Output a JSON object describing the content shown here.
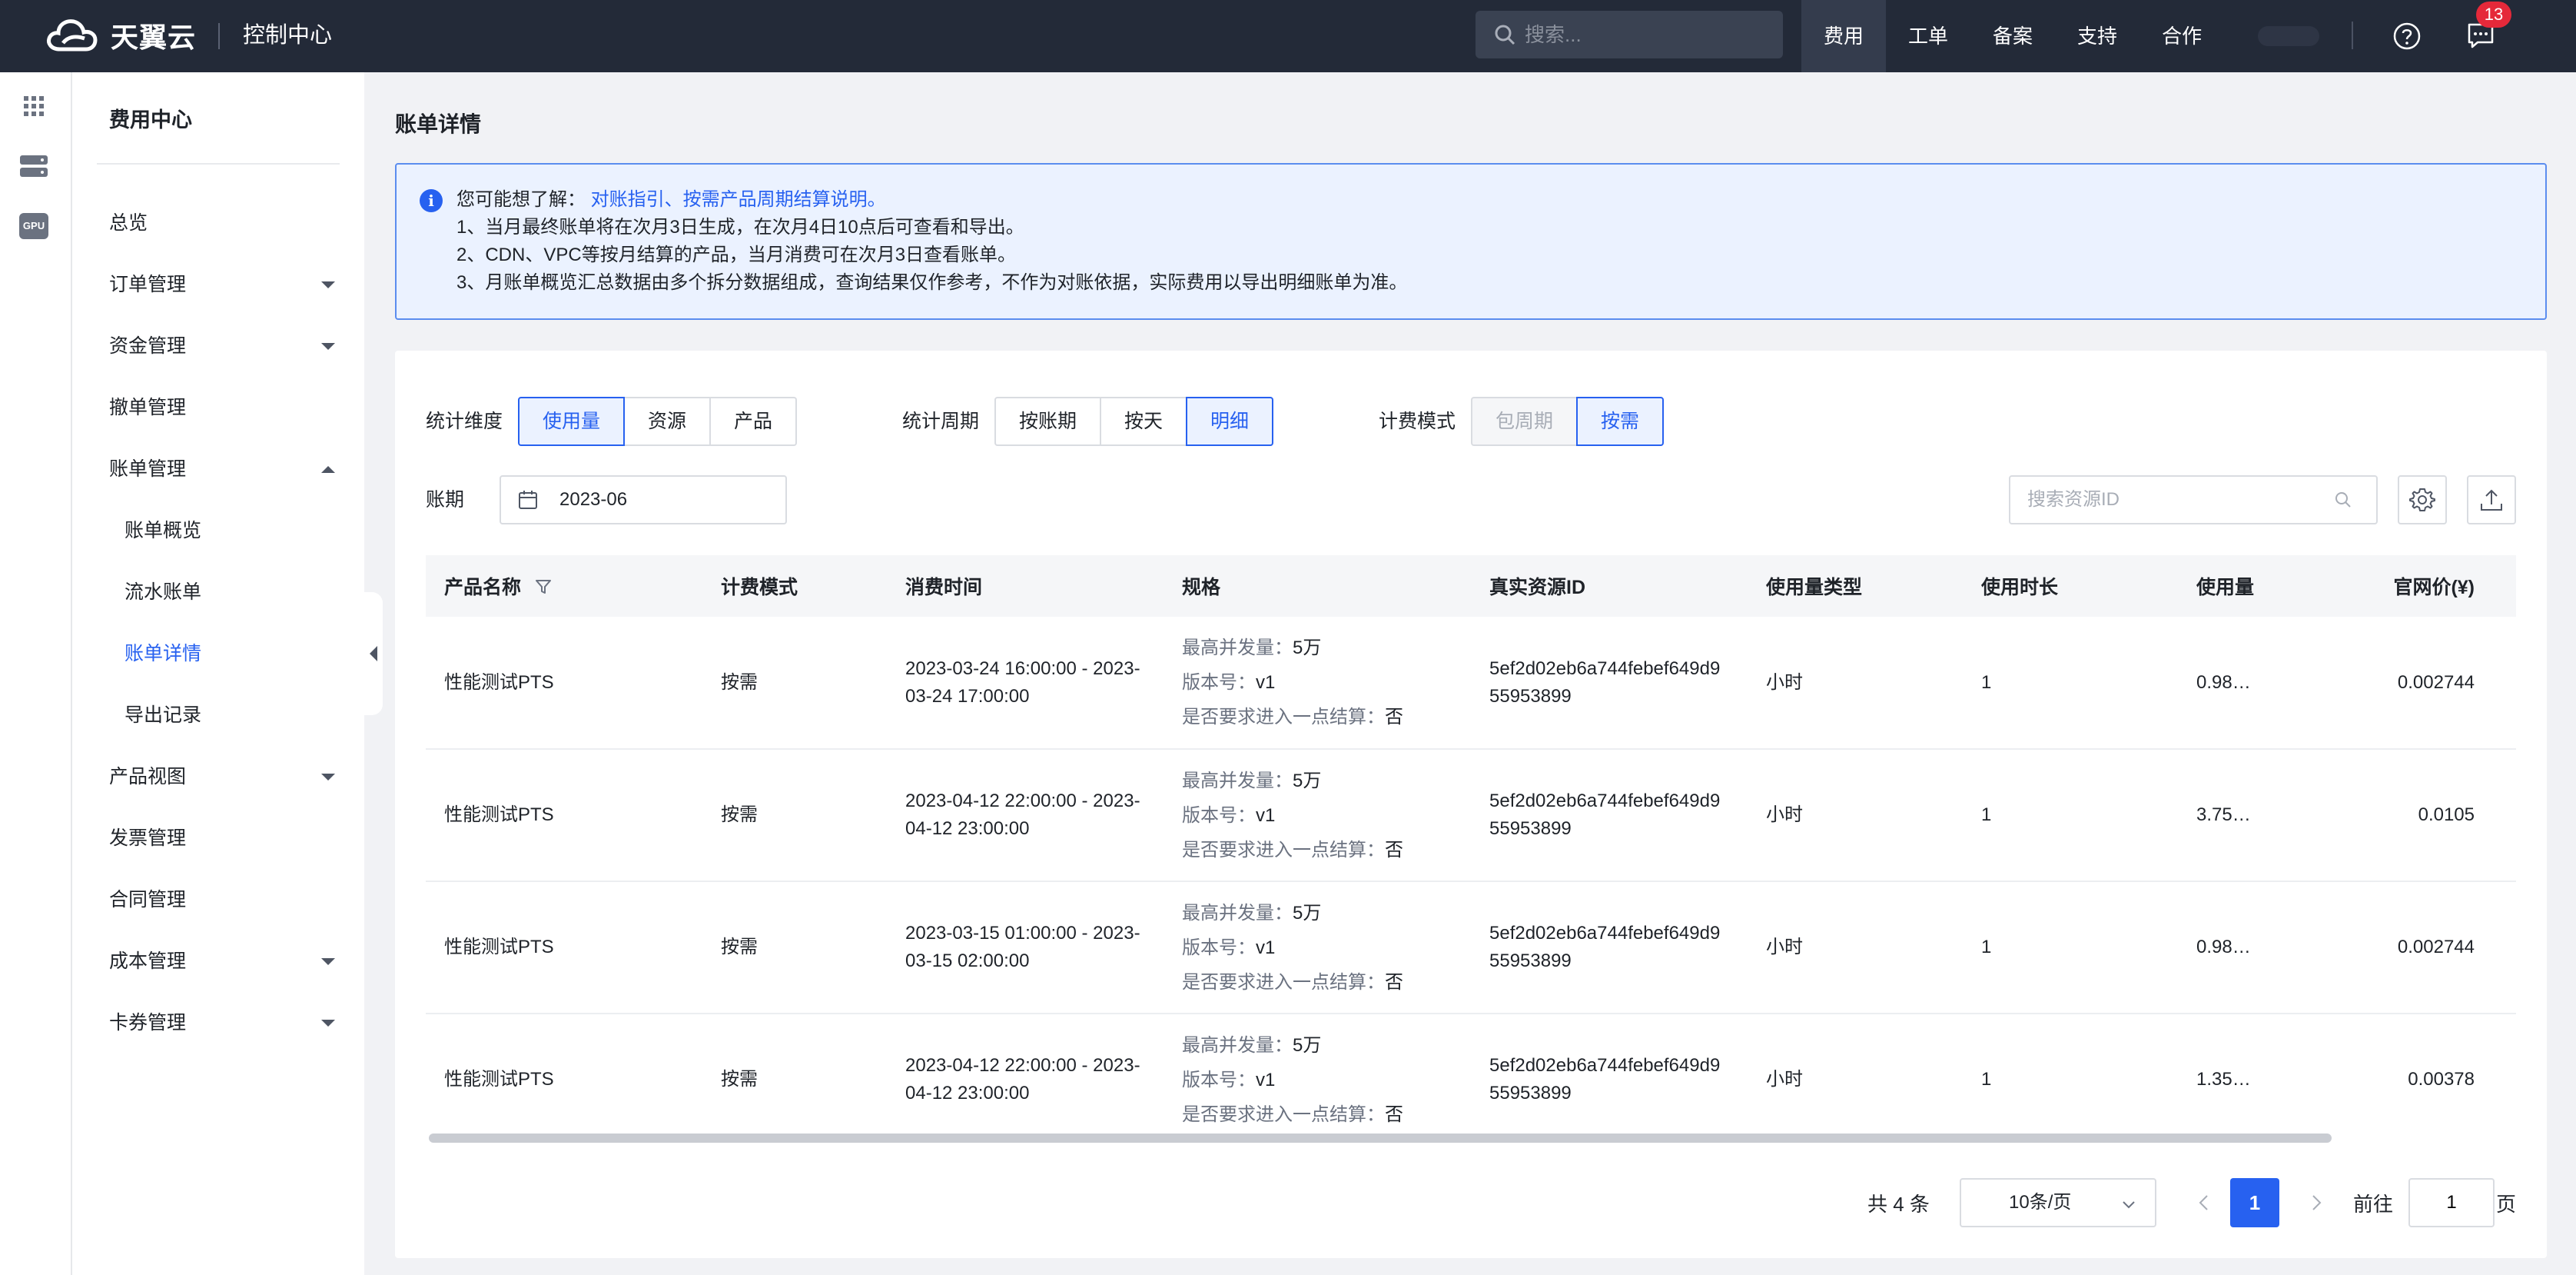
{
  "topbar": {
    "logo_text": "天翼云",
    "console_title": "控制中心",
    "search_placeholder": "搜索...",
    "nav": [
      "费用",
      "工单",
      "备案",
      "支持",
      "合作"
    ],
    "message_count": "13"
  },
  "rail": {
    "gpu_label": "GPU"
  },
  "sidebar": {
    "title": "费用中心",
    "items": [
      {
        "label": "总览"
      },
      {
        "label": "订单管理"
      },
      {
        "label": "资金管理"
      },
      {
        "label": "撤单管理"
      },
      {
        "label": "账单管理"
      },
      {
        "label": "账单概览"
      },
      {
        "label": "流水账单"
      },
      {
        "label": "账单详情"
      },
      {
        "label": "导出记录"
      },
      {
        "label": "产品视图"
      },
      {
        "label": "发票管理"
      },
      {
        "label": "合同管理"
      },
      {
        "label": "成本管理"
      },
      {
        "label": "卡券管理"
      }
    ]
  },
  "page": {
    "title": "账单详情"
  },
  "notice": {
    "prefix": "您可能想了解：",
    "links": "对账指引、按需产品周期结算说明。",
    "line1": "1、当月最终账单将在次月3日生成，在次月4日10点后可查看和导出。",
    "line2": "2、CDN、VPC等按月结算的产品，当月消费可在次月3日查看账单。",
    "line3": "3、月账单概览汇总数据由多个拆分数据组成，查询结果仅作参考，不作为对账依据，实际费用以导出明细账单为准。"
  },
  "filters": {
    "dimension_label": "统计维度",
    "dimension_options": [
      "使用量",
      "资源",
      "产品"
    ],
    "period_label": "统计周期",
    "period_options": [
      "按账期",
      "按天",
      "明细"
    ],
    "billing_label": "计费模式",
    "billing_options": [
      "包周期",
      "按需"
    ],
    "bill_period_label": "账期",
    "bill_period_value": "2023-06",
    "resource_search_placeholder": "搜索资源ID"
  },
  "table": {
    "columns": [
      "产品名称",
      "计费模式",
      "消费时间",
      "规格",
      "真实资源ID",
      "使用量类型",
      "使用时长",
      "使用量",
      "官网价(¥)"
    ],
    "spec_keys": [
      "最高并发量：",
      "版本号：",
      "是否要求进入一点结算："
    ],
    "rows": [
      {
        "product": "性能测试PTS",
        "mode": "按需",
        "time": "2023-03-24 16:00:00 - 2023-03-24 17:00:00",
        "spec": [
          "5万",
          "v1",
          "否"
        ],
        "resource_id": "5ef2d02eb6a744febef649d955953899",
        "usage_type": "小时",
        "duration": "1",
        "usage": "0.98…",
        "price": "0.002744"
      },
      {
        "product": "性能测试PTS",
        "mode": "按需",
        "time": "2023-04-12 22:00:00 - 2023-04-12 23:00:00",
        "spec": [
          "5万",
          "v1",
          "否"
        ],
        "resource_id": "5ef2d02eb6a744febef649d955953899",
        "usage_type": "小时",
        "duration": "1",
        "usage": "3.75…",
        "price": "0.0105"
      },
      {
        "product": "性能测试PTS",
        "mode": "按需",
        "time": "2023-03-15 01:00:00 - 2023-03-15 02:00:00",
        "spec": [
          "5万",
          "v1",
          "否"
        ],
        "resource_id": "5ef2d02eb6a744febef649d955953899",
        "usage_type": "小时",
        "duration": "1",
        "usage": "0.98…",
        "price": "0.002744"
      },
      {
        "product": "性能测试PTS",
        "mode": "按需",
        "time": "2023-04-12 22:00:00 - 2023-04-12 23:00:00",
        "spec": [
          "5万",
          "v1",
          "否"
        ],
        "resource_id": "5ef2d02eb6a744febef649d955953899",
        "usage_type": "小时",
        "duration": "1",
        "usage": "1.35…",
        "price": "0.00378"
      }
    ]
  },
  "pagination": {
    "total": "共 4 条",
    "page_size": "10条/页",
    "current": "1",
    "goto_label": "前往",
    "goto_value": "1",
    "page_suffix": "页"
  },
  "colors": {
    "topbar": "#232a38",
    "accent": "#2761f0",
    "badge": "#e5293a"
  }
}
